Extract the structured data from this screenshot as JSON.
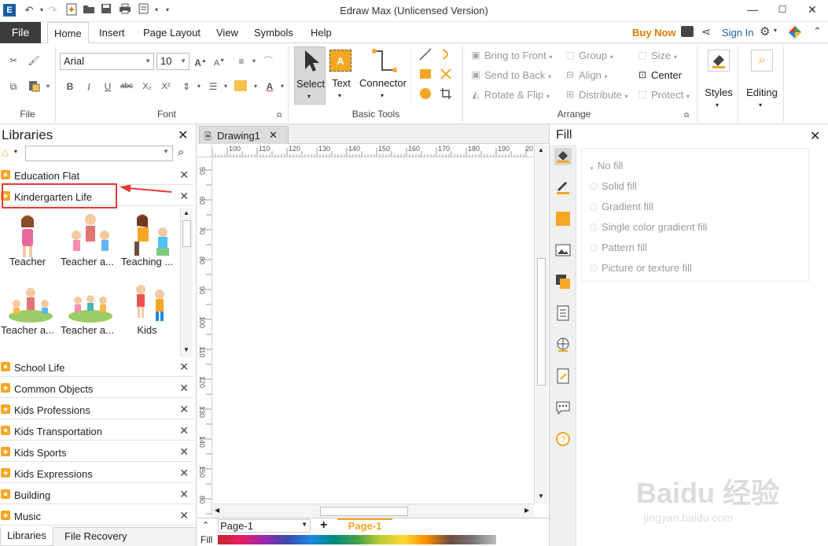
{
  "window": {
    "title": "Edraw Max (Unlicensed Version)"
  },
  "menu": {
    "file": "File",
    "tabs": [
      "Home",
      "Insert",
      "Page Layout",
      "View",
      "Symbols",
      "Help"
    ],
    "buy_now": "Buy Now",
    "sign_in": "Sign In"
  },
  "ribbon": {
    "groups": {
      "file": "File",
      "font": "Font",
      "basic_tools": "Basic Tools",
      "arrange": "Arrange"
    },
    "font_name": "Arial",
    "font_size": "10",
    "tools": {
      "select": "Select",
      "text": "Text",
      "connector": "Connector"
    },
    "arrange": {
      "bring_to_front": "Bring to Front",
      "send_to_back": "Send to Back",
      "rotate_flip": "Rotate & Flip",
      "group": "Group",
      "align": "Align",
      "distribute": "Distribute",
      "size": "Size",
      "center": "Center",
      "protect": "Protect"
    },
    "styles": "Styles",
    "editing": "Editing"
  },
  "libraries": {
    "title": "Libraries",
    "open_library": "Kindergarten Life",
    "items_top": [
      "Education Flat",
      "Kindergarten Life"
    ],
    "shapes": [
      "Teacher",
      "Teacher a...",
      "Teaching ...",
      "Teacher a...",
      "Teacher a...",
      "Kids"
    ],
    "items_bottom": [
      "School Life",
      "Common Objects",
      "Kids Professions",
      "Kids Transportation",
      "Kids Sports",
      "Kids Expressions",
      "Building",
      "Music"
    ]
  },
  "bottom_tabs": {
    "libraries": "Libraries",
    "file_recovery": "File Recovery"
  },
  "document": {
    "tab": "Drawing1",
    "page_name": "Page-1",
    "page_tab": "Page-1",
    "fill_label": "Fill"
  },
  "rulers": {
    "top": [
      "100",
      "110",
      "120",
      "130",
      "140",
      "150",
      "160",
      "170",
      "180",
      "190",
      "20"
    ],
    "left": [
      "50",
      "60",
      "70",
      "80",
      "90",
      "100",
      "110",
      "120",
      "130",
      "140",
      "150",
      "60"
    ]
  },
  "fill": {
    "title": "Fill",
    "options": [
      "No fill",
      "Solid fill",
      "Gradient fill",
      "Single color gradient fill",
      "Pattern fill",
      "Picture or texture fill"
    ]
  },
  "watermark": {
    "brand": "Baidu 经验",
    "url": "jingyan.baidu.com"
  },
  "colors": {
    "accent": "#f5a623",
    "highlight_red": "#e53935",
    "file_tab": "#3c3c3c",
    "buy_now": "#e07b00"
  }
}
